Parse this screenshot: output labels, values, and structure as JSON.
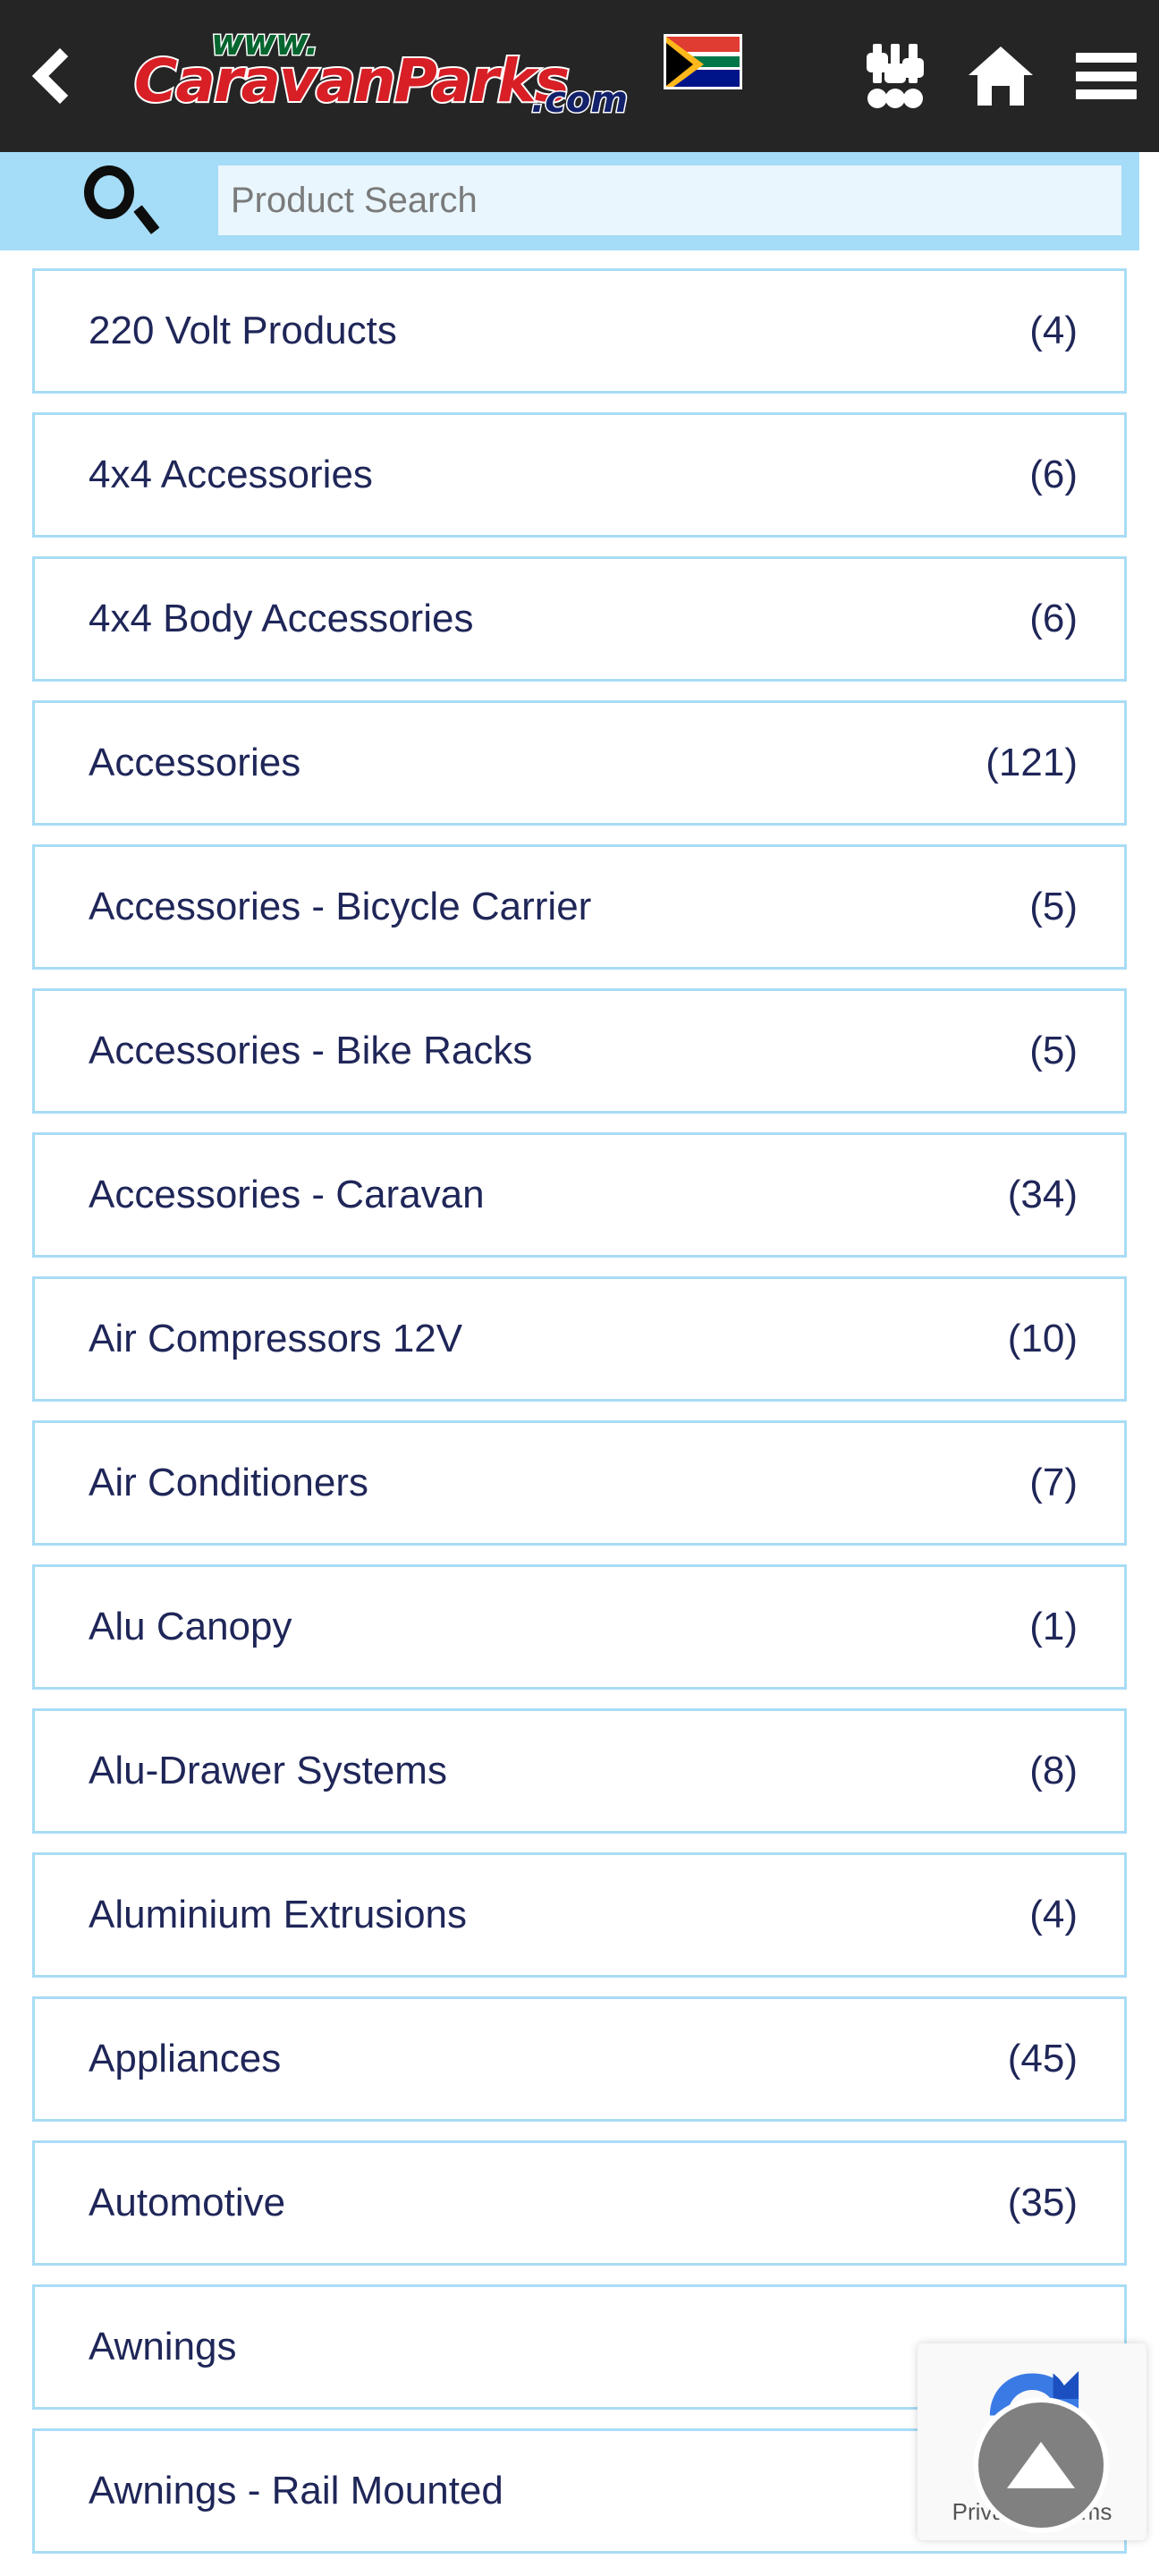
{
  "header": {
    "back_icon": "chevron-left-icon",
    "logo": {
      "prefix": "www.",
      "name": "CaravanParks",
      "suffix": ".com",
      "flag": "south-africa-flag",
      "colors": {
        "prefix": "#04652f",
        "name": "#d81f26",
        "suffix": "#13216b"
      }
    },
    "icons": [
      {
        "name": "sliders-icon",
        "label": "Filters"
      },
      {
        "name": "home-icon",
        "label": "Home"
      },
      {
        "name": "hamburger-menu-icon",
        "label": "Menu"
      }
    ],
    "background": "#252525"
  },
  "search": {
    "icon": "search-icon",
    "placeholder": "Product Search",
    "value": "",
    "bar_background": "#a5dcf7",
    "field_background": "#e9f6fd"
  },
  "categories": {
    "border_color": "#a8dcf5",
    "text_color": "#1f2658",
    "items": [
      {
        "label": "220 Volt Products",
        "count": "(4)"
      },
      {
        "label": "4x4 Accessories",
        "count": "(6)"
      },
      {
        "label": "4x4 Body Accessories",
        "count": "(6)"
      },
      {
        "label": "Accessories",
        "count": "(121)"
      },
      {
        "label": "Accessories - Bicycle Carrier",
        "count": "(5)"
      },
      {
        "label": "Accessories - Bike Racks",
        "count": "(5)"
      },
      {
        "label": "Accessories - Caravan",
        "count": "(34)"
      },
      {
        "label": "Air Compressors 12V",
        "count": "(10)"
      },
      {
        "label": "Air Conditioners",
        "count": "(7)"
      },
      {
        "label": "Alu Canopy",
        "count": "(1)"
      },
      {
        "label": "Alu-Drawer Systems",
        "count": "(8)"
      },
      {
        "label": "Aluminium Extrusions",
        "count": "(4)"
      },
      {
        "label": "Appliances",
        "count": "(45)"
      },
      {
        "label": "Automotive",
        "count": "(35)"
      },
      {
        "label": "Awnings",
        "count": ""
      },
      {
        "label": "Awnings - Rail Mounted",
        "count": ""
      }
    ]
  },
  "recaptcha": {
    "icon": "recaptcha-logo-icon",
    "text": "Privacy - Terms"
  },
  "scroll_top": {
    "icon": "triangle-up-icon",
    "label": "Back to top",
    "background": "#808080"
  }
}
